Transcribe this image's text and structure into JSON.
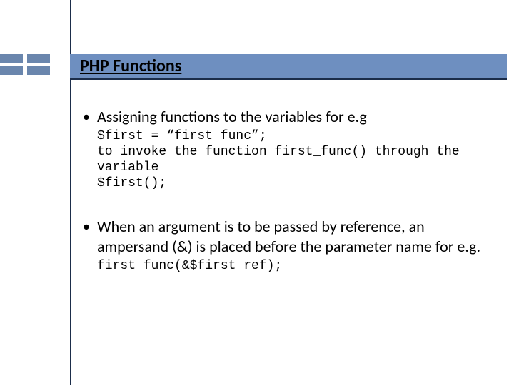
{
  "slide": {
    "title": "PHP Functions",
    "bullets": [
      {
        "text": "Assigning functions to the variables for e.g",
        "code": "$first = “first_func”;\nto invoke the function first_func() through the variable\n$first();"
      },
      {
        "text": "When an argument is to be passed by reference, an ampersand (&) is placed before the parameter name for e.g.",
        "code": "first_func(&$first_ref);"
      }
    ]
  }
}
